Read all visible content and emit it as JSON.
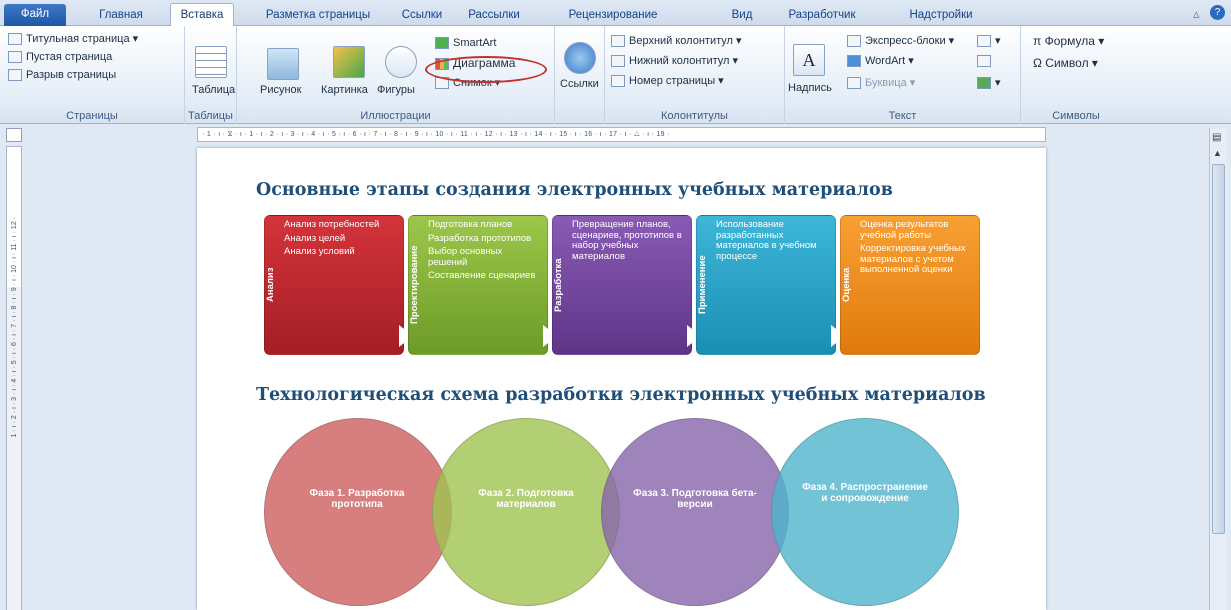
{
  "tabs": [
    "Файл",
    "Главная",
    "Вставка",
    "Разметка страницы",
    "Ссылки",
    "Рассылки",
    "Рецензирование",
    "Вид",
    "Разработчик",
    "Надстройки"
  ],
  "ribbon": {
    "pages": {
      "items": [
        "Титульная страница ▾",
        "Пустая страница",
        "Разрыв страницы"
      ],
      "label": "Страницы"
    },
    "tables": {
      "button": "Таблица",
      "label": "Таблицы"
    },
    "illustrations": {
      "picture": "Рисунок",
      "clipart": "Картинка",
      "shapes": "Фигуры",
      "smartart": "SmartArt",
      "chart": "Диаграмма",
      "screenshot": "Снимок ▾",
      "label": "Иллюстрации"
    },
    "links": {
      "button": "Ссылки"
    },
    "headers": {
      "items": [
        "Верхний колонтитул ▾",
        "Нижний колонтитул ▾",
        "Номер страницы ▾"
      ],
      "label": "Колонтитулы"
    },
    "text": {
      "textbox": "Надпись",
      "quickparts": "Экспресс-блоки ▾",
      "wordart": "WordArt ▾",
      "dropcap": "Буквица ▾",
      "label": "Текст"
    },
    "symbols": {
      "formula": "π Формула ▾",
      "symbol": "Ω Символ ▾",
      "label": "Символы"
    }
  },
  "ruler": {
    "horizontal": "· 1 · ı · ⧖ · ı · 1 · ı · 2 · ı · 3 · ı · 4 · ı · 5 · ı · 6 · ı · 7 · ı · 8 · ı · 9 · ı · 10 · ı · 11 · ı · 12 · ı · 13 · ı · 14 · ı · 15 · ı · 16 · ı · 17 · ı · △ · ı · 19 ·",
    "vertical": "1 · ı · 2 · ı · 3 · ı · 4 · ı · 5 · ı · 6 · ı · 7 · ı · 8 · ı · 9 · ı · 10 · ı · 11 · ı · 12 ·"
  },
  "doc": {
    "heading1": "Основные этапы создания электронных учебных материалов",
    "heading2": "Технологическая схема разработки электронных учебных материалов",
    "process": [
      {
        "title": "Анализ",
        "color": "#c0262e",
        "bullets": [
          "Анализ потребностей",
          "Анализ целей",
          "Анализ условий"
        ]
      },
      {
        "title": "Проектирование",
        "color": "#8cb83a",
        "bullets": [
          "Подготовка планов",
          "Разработка прототипов",
          "Выбор основных решений",
          "Составление сценариев"
        ]
      },
      {
        "title": "Разработка",
        "color": "#7a4ba3",
        "bullets": [
          "Превращение планов, сценариев, прототипов в набор учебных материалов"
        ]
      },
      {
        "title": "Применение",
        "color": "#2aa7c9",
        "bullets": [
          "Использование разработанных материалов в учебном процессе"
        ]
      },
      {
        "title": "Оценка",
        "color": "#f08c1a",
        "bullets": [
          "Оценка результатов учебной работы",
          "Корректировка учебных материалов с учетом выполненной оценки"
        ]
      }
    ],
    "phases": [
      {
        "label": "Фаза 1. Разработка прототипа",
        "color": "rgba(205,95,95,0.8)"
      },
      {
        "label": "Фаза 2. Подготовка материалов",
        "color": "rgba(160,195,80,0.8)"
      },
      {
        "label": "Фаза 3. Подготовка бета-версии",
        "color": "rgba(135,100,170,0.8)"
      },
      {
        "label": "Фаза 4. Распространение и сопровождение",
        "color": "rgba(80,180,205,0.8)"
      }
    ]
  }
}
